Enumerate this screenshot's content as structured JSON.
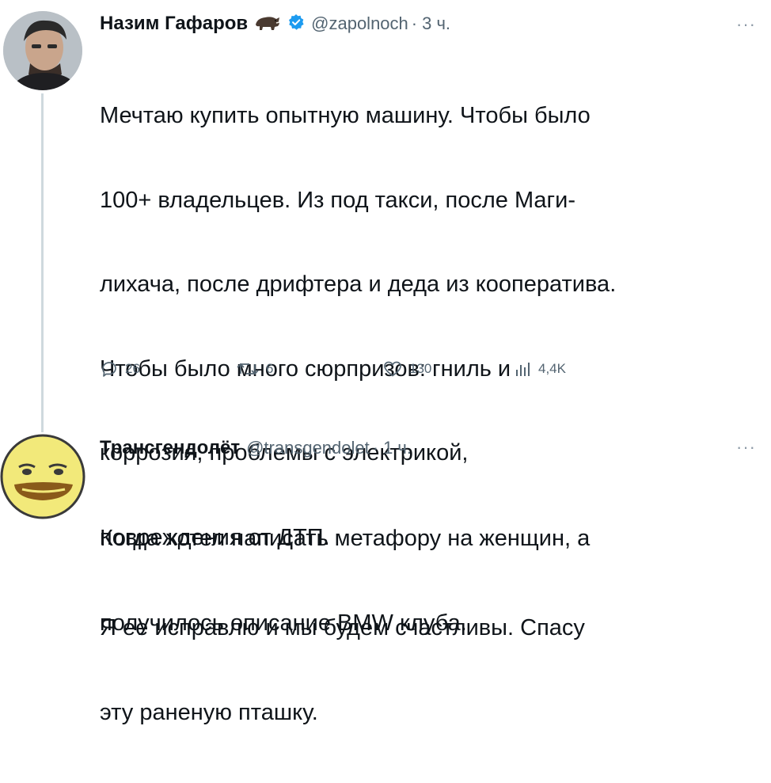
{
  "tweets": [
    {
      "author_name": "Назим Гафаров",
      "handle": "@zapolnoch",
      "time": "3 ч.",
      "more_label": "···",
      "emoji_icon": "boar-icon",
      "verified_icon": "verified-badge-icon",
      "lines": [
        "Мечтаю купить опытную машину. Чтобы было",
        "100+ владельцев. Из под такси, после Маги-",
        "лихача, после дрифтера и деда из кооператива.",
        "Чтобы было много сюрпризов: гниль и",
        "коррозия, проблемы с электрикой,",
        "повреждения от ДТП.",
        "Я ее исправлю и мы будем счастливы. Спасу",
        "эту раненую пташку."
      ],
      "actions": {
        "replies": "26",
        "retweets": "6",
        "likes": "130",
        "views": "4,4K"
      }
    },
    {
      "author_name": "Трансгендолёт",
      "handle": "@transgendolet",
      "time": "1 ч.",
      "more_label": "···",
      "lines": [
        "Когда хотел написать метафору на женщин, а",
        "получилось описание BMW клуба."
      ]
    }
  ],
  "colors": {
    "text": "#0f1419",
    "secondary": "#536471",
    "verified": "#1d9bf0",
    "thread_line": "#cfd9de"
  }
}
